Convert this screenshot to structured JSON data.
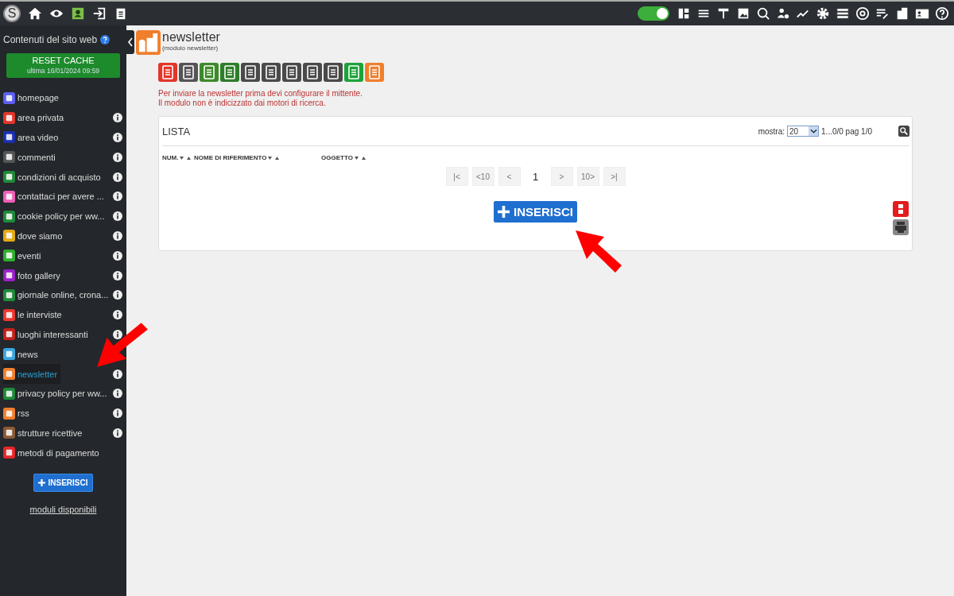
{
  "topbar": {
    "logo": "S",
    "toggle": {
      "on": true
    }
  },
  "sidebar": {
    "title": "Contenuti del sito web",
    "reset": {
      "label": "RESET CACHE",
      "sub": "ultima 16/01/2024 09:59"
    },
    "items": [
      {
        "label": "homepage",
        "color": "#5b5ef0",
        "info": false,
        "selected": false
      },
      {
        "label": "area privata",
        "color": "#e2362c",
        "info": true,
        "selected": false
      },
      {
        "label": "area video",
        "color": "#1b2fb0",
        "info": true,
        "selected": false
      },
      {
        "label": "commenti",
        "color": "#555555",
        "info": true,
        "selected": false
      },
      {
        "label": "condizioni di acquisto",
        "color": "#1f8a3a",
        "info": true,
        "selected": false
      },
      {
        "label": "contattaci per avere ...",
        "color": "#ee5fb6",
        "info": true,
        "selected": false
      },
      {
        "label": "cookie policy per ww...",
        "color": "#1f8a3a",
        "info": true,
        "selected": false
      },
      {
        "label": "dove siamo",
        "color": "#e3a812",
        "info": true,
        "selected": false
      },
      {
        "label": "eventi",
        "color": "#2fae2f",
        "info": true,
        "selected": false
      },
      {
        "label": "foto gallery",
        "color": "#9a1fc9",
        "info": true,
        "selected": false
      },
      {
        "label": "giornale online, crona...",
        "color": "#1f8a3a",
        "info": true,
        "selected": false
      },
      {
        "label": "le interviste",
        "color": "#e8382f",
        "info": true,
        "selected": false
      },
      {
        "label": "luoghi interessanti",
        "color": "#c0221e",
        "info": true,
        "selected": false
      },
      {
        "label": "news",
        "color": "#3aa6e0",
        "info": false,
        "selected": false
      },
      {
        "label": "newsletter",
        "color": "#f07f2c",
        "info": true,
        "selected": true
      },
      {
        "label": "privacy policy per ww...",
        "color": "#1f8a3a",
        "info": true,
        "selected": false
      },
      {
        "label": "rss",
        "color": "#f07f2c",
        "info": true,
        "selected": false
      },
      {
        "label": "strutture ricettive",
        "color": "#8a5a35",
        "info": true,
        "selected": false
      },
      {
        "label": "metodi di pagamento",
        "color": "#e3262b",
        "info": false,
        "selected": false
      }
    ],
    "insert": "INSERISCI",
    "available": "moduli disponibili"
  },
  "module": {
    "title": "newsletter",
    "subtitle": "(modulo newsletter)",
    "tools": [
      {
        "color": "#e0372a"
      },
      {
        "color": "#555555"
      },
      {
        "color": "#3d8a2a"
      },
      {
        "color": "#2e7d2a"
      },
      {
        "color": "#4a4a4a"
      },
      {
        "color": "#4a4a4a"
      },
      {
        "color": "#4a4a4a"
      },
      {
        "color": "#4a4a4a"
      },
      {
        "color": "#4a4a4a"
      },
      {
        "color": "#1ea23a"
      },
      {
        "color": "#f07f2c"
      }
    ],
    "notes": [
      "Per inviare la newsletter prima devi configurare il mittente.",
      "Il modulo non è indicizzato dai motori di ricerca."
    ]
  },
  "list": {
    "title": "LISTA",
    "show_label": "mostra:",
    "show_value": "20",
    "range": "1...0/0 pag 1/0",
    "columns": [
      "NUM.",
      "NOME DI RIFERIMENTO",
      "OGGETTO"
    ],
    "pages": [
      {
        "label": "|<",
        "current": false
      },
      {
        "label": "<10",
        "current": false
      },
      {
        "label": "<",
        "current": false
      },
      {
        "label": "1",
        "current": true
      },
      {
        "label": ">",
        "current": false
      },
      {
        "label": "10>",
        "current": false
      },
      {
        "label": ">|",
        "current": false
      }
    ],
    "insert": "INSERISCI"
  }
}
